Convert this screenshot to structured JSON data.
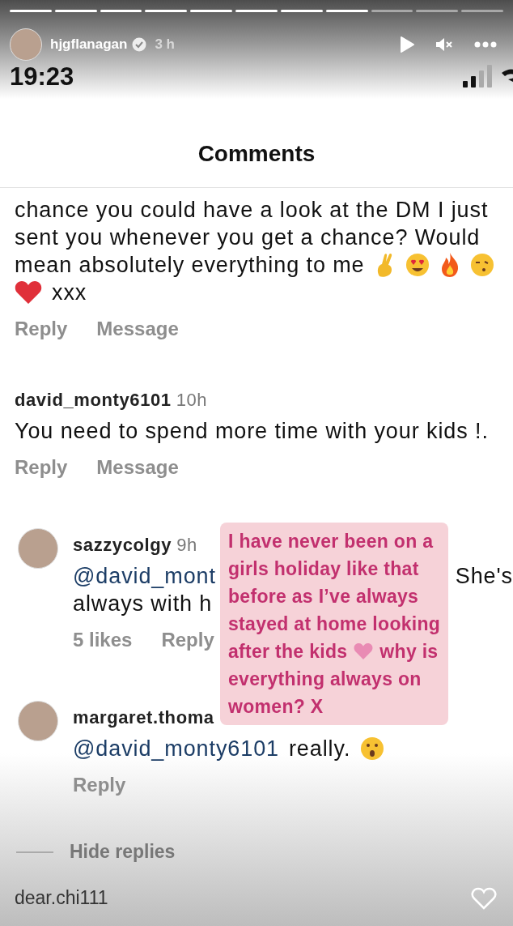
{
  "story": {
    "progress": [
      {
        "viewed": true
      },
      {
        "viewed": true
      },
      {
        "viewed": true
      },
      {
        "viewed": true
      },
      {
        "viewed": true
      },
      {
        "viewed": true
      },
      {
        "viewed": true
      },
      {
        "viewed": true
      },
      {
        "viewed": false
      },
      {
        "viewed": false
      },
      {
        "viewed": false
      }
    ],
    "username": "hjgflanagan",
    "verified": true,
    "time": "3 h"
  },
  "status_bar": {
    "time": "19:23"
  },
  "title": "Comments",
  "comments": [
    {
      "kind": "comment",
      "lines": [
        [
          {
            "kind": "text",
            "text": "chance you could have a look at the DM I just"
          }
        ],
        [
          {
            "kind": "text",
            "text": "sent you whenever you get a chance? Would"
          }
        ],
        [
          {
            "kind": "text",
            "text": "mean absolutely everything to me"
          },
          {
            "kind": "fingers"
          },
          {
            "kind": "hearteyes"
          },
          {
            "kind": "fire"
          },
          {
            "kind": "kiss"
          }
        ],
        [
          {
            "kind": "heart"
          },
          {
            "kind": "text",
            "text": "xxx"
          }
        ]
      ],
      "actions": [
        "Reply",
        "Message"
      ]
    },
    {
      "kind": "comment",
      "username": "david_monty6101",
      "time": "10h",
      "lines": [
        [
          {
            "kind": "text",
            "text": "You need to spend more time with your kids !."
          }
        ]
      ],
      "actions": [
        "Reply",
        "Message"
      ]
    },
    {
      "kind": "reply",
      "username": "sazzycolgy",
      "time": "9h",
      "lines": [
        [
          {
            "kind": "mention",
            "text": "@david_mont"
          },
          {
            "kind": "tail",
            "text": "She's"
          }
        ],
        [
          {
            "kind": "text",
            "text": "always with h"
          }
        ]
      ],
      "actions": [
        "5 likes",
        "Reply"
      ]
    },
    {
      "kind": "reply",
      "username": "margaret.thoma",
      "lines": [
        [
          {
            "kind": "mention",
            "text": "@david_monty6101"
          },
          {
            "kind": "text",
            "text": "really."
          },
          {
            "kind": "surprised"
          }
        ]
      ],
      "actions": [
        "Reply"
      ]
    }
  ],
  "hide_replies": "Hide replies",
  "next_username": "dear.chi111",
  "sticker": {
    "lines": [
      {
        "segments": [
          "I have never been on a"
        ]
      },
      {
        "segments": [
          "girls holiday like that"
        ]
      },
      {
        "segments": [
          "before as I’ve always"
        ]
      },
      {
        "segments": [
          "stayed at home looking"
        ]
      },
      {
        "segments": [
          "after the kids",
          "why is"
        ]
      },
      {
        "segments": [
          "everything always on"
        ]
      },
      {
        "segments": [
          "women? X"
        ]
      }
    ]
  }
}
